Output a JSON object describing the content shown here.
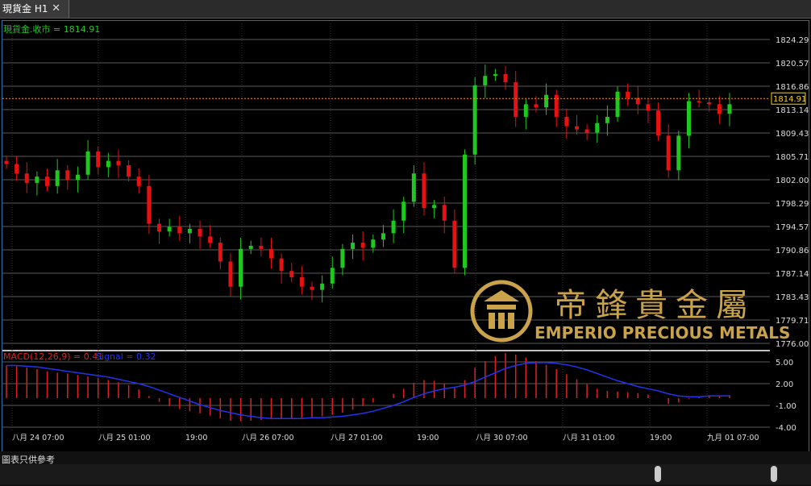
{
  "tab": {
    "title": "現貨金 H1",
    "close": "✕"
  },
  "price_legend": "現貨金.收市 = 1814.91",
  "macd_legend": {
    "main": "MACD(12,26,9) = 0.41",
    "signal": "Signal = 0.32"
  },
  "current_price": "1814.91",
  "price_axis": [
    "1824.29",
    "1820.57",
    "1816.86",
    "1813.14",
    "1809.43",
    "1805.71",
    "1802.00",
    "1798.29",
    "1794.57",
    "1790.86",
    "1787.14",
    "1783.43",
    "1779.71",
    "1776.00"
  ],
  "macd_axis": [
    "5.00",
    "2.00",
    "-1.00",
    "-4.00"
  ],
  "time_axis": [
    "八月 24 07:00",
    "八月 25 01:00",
    "19:00",
    "八月 26 07:00",
    "八月 27 01:00",
    "19:00",
    "八月 30 07:00",
    "八月 31 01:00",
    "19:00",
    "九月 01 07:00"
  ],
  "logo": {
    "chinese": "帝鋒貴金屬",
    "english": "EMPERIO PRECIOUS METALS"
  },
  "footer_note": "圖表只供參考",
  "colors": {
    "up": "#1ec81e",
    "down": "#e81010",
    "macd_hist": "#e02020",
    "signal": "#2233ee",
    "price_line": "#ff9900",
    "logo_gold": "#c9a24a"
  },
  "chart_data": {
    "type": "candlestick",
    "price_ylim": [
      1776.0,
      1824.29
    ],
    "price_close": [
      1804.5,
      1803.0,
      1801.5,
      1802.5,
      1801.0,
      1803.5,
      1802.0,
      1802.8,
      1806.5,
      1804.0,
      1805.0,
      1804.3,
      1802.5,
      1801.0,
      1795.0,
      1793.8,
      1794.5,
      1793.5,
      1794.2,
      1793.0,
      1792.0,
      1789.0,
      1785.0,
      1791.0,
      1791.5,
      1791.0,
      1789.5,
      1787.5,
      1786.5,
      1785.0,
      1784.5,
      1785.5,
      1788.0,
      1791.0,
      1792.0,
      1791.2,
      1792.5,
      1793.5,
      1795.5,
      1798.5,
      1803.0,
      1797.5,
      1798.0,
      1795.5,
      1788.0,
      1806.0,
      1817.0,
      1818.5,
      1818.8,
      1817.5,
      1812.0,
      1814.0,
      1813.5,
      1815.5,
      1812.0,
      1810.5,
      1810.0,
      1809.5,
      1811.0,
      1812.0,
      1816.0,
      1815.0,
      1814.0,
      1813.0,
      1809.0,
      1803.5,
      1809.0,
      1814.5,
      1814.3,
      1814.0,
      1812.5,
      1814.0
    ],
    "macd": [
      4.5,
      4.4,
      4.2,
      4.0,
      3.7,
      3.5,
      3.4,
      3.2,
      3.0,
      2.8,
      2.5,
      2.2,
      1.8,
      1.2,
      0.3,
      -0.5,
      -1.1,
      -1.5,
      -1.8,
      -2.1,
      -2.4,
      -2.8,
      -3.1,
      -3.2,
      -3.1,
      -3.0,
      -2.9,
      -2.9,
      -2.8,
      -2.7,
      -2.6,
      -2.5,
      -2.3,
      -2.0,
      -1.6,
      -1.1,
      -0.6,
      0.0,
      0.6,
      1.3,
      2.1,
      2.5,
      2.4,
      2.0,
      1.4,
      2.5,
      4.2,
      5.1,
      5.8,
      6.2,
      6.0,
      5.6,
      5.1,
      4.6,
      4.0,
      3.3,
      2.6,
      1.9,
      1.3,
      1.0,
      0.9,
      0.8,
      0.7,
      0.5,
      0.0,
      -0.8,
      -0.6,
      -0.1,
      0.2,
      0.4,
      0.4,
      0.41
    ],
    "signal": [
      4.5,
      4.5,
      4.4,
      4.3,
      4.1,
      3.9,
      3.7,
      3.5,
      3.3,
      3.1,
      2.9,
      2.6,
      2.3,
      2.0,
      1.6,
      1.1,
      0.6,
      0.1,
      -0.4,
      -0.9,
      -1.3,
      -1.7,
      -2.0,
      -2.3,
      -2.5,
      -2.7,
      -2.8,
      -2.8,
      -2.8,
      -2.8,
      -2.7,
      -2.7,
      -2.6,
      -2.5,
      -2.3,
      -2.1,
      -1.8,
      -1.4,
      -1.0,
      -0.5,
      0.1,
      0.6,
      1.0,
      1.3,
      1.5,
      1.8,
      2.3,
      2.9,
      3.5,
      4.1,
      4.5,
      4.8,
      4.9,
      4.9,
      4.8,
      4.6,
      4.3,
      3.9,
      3.4,
      2.9,
      2.4,
      2.0,
      1.6,
      1.3,
      1.0,
      0.6,
      0.3,
      0.2,
      0.2,
      0.3,
      0.3,
      0.32
    ],
    "macd_ylim": [
      -4.0,
      6.0
    ]
  }
}
